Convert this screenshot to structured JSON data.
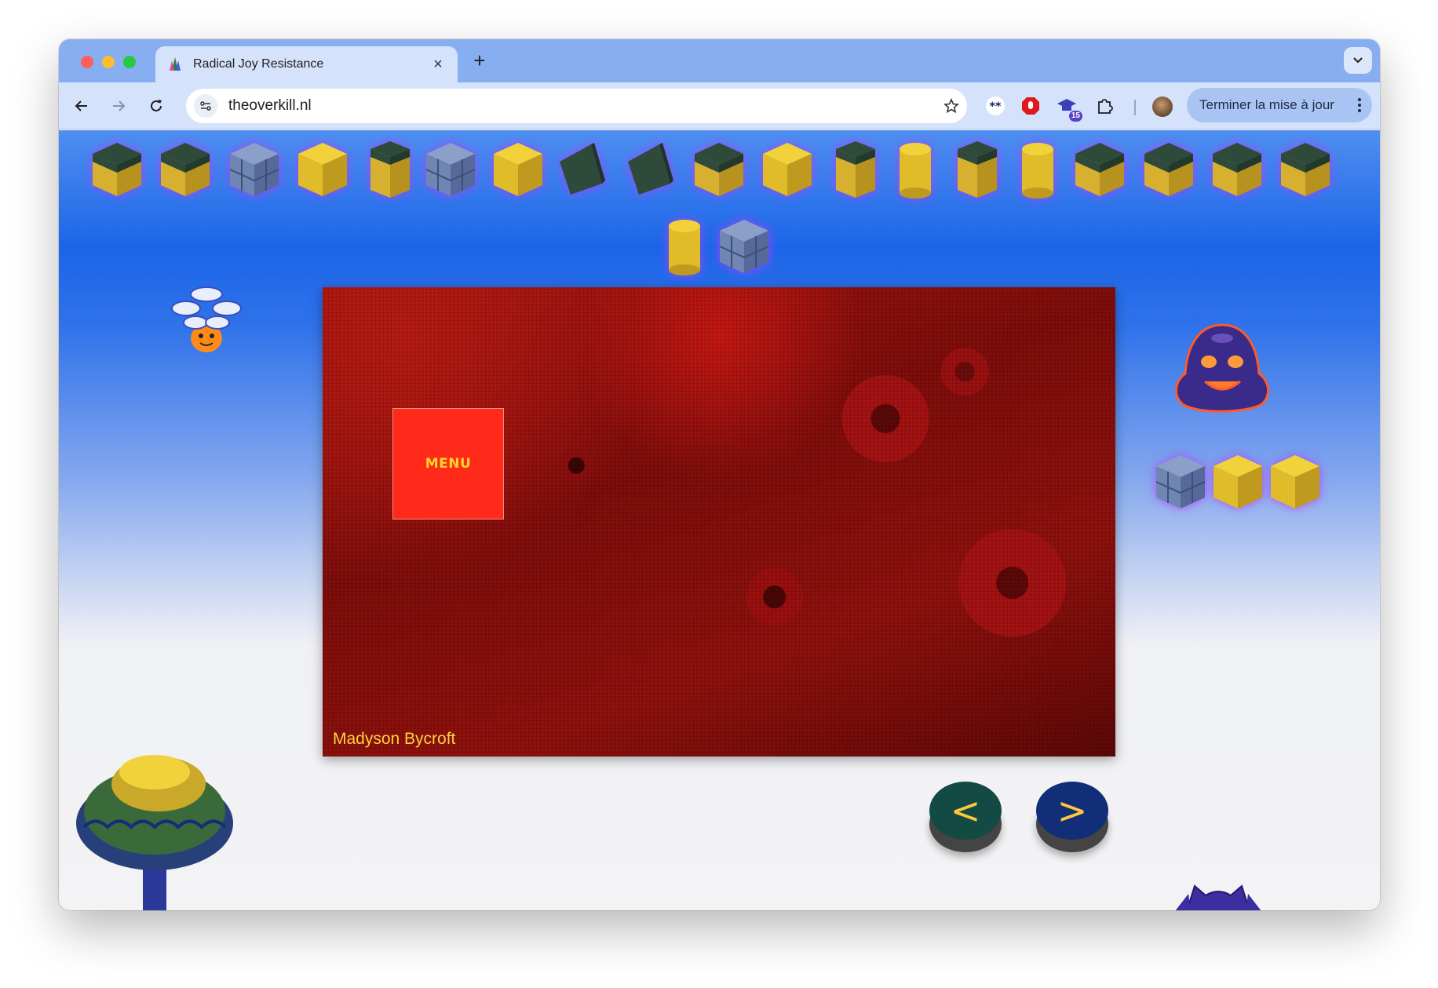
{
  "browser": {
    "tab": {
      "title": "Radical Joy Resistance",
      "close_icon": "close-icon"
    },
    "new_tab_label": "+",
    "url": "theoverkill.nl",
    "update_button_label": "Terminer la mise à jour",
    "extension_badge": "15"
  },
  "page": {
    "menu_label": "MENU",
    "artwork_caption": "Madyson Bycroft",
    "prev_label": "<",
    "next_label": ">"
  },
  "colors": {
    "tab_strip": "#87aef0",
    "toolbar": "#d4e2fb",
    "menu_button": "#ff2a1a",
    "menu_text": "#ffd62a",
    "caption_text": "#ffd23a",
    "prev_button": "#134a44",
    "next_button": "#132e78"
  },
  "blocks_top_row": [
    "grass-block-icon",
    "grass-block-icon",
    "stone-block-icon",
    "sand-block-icon",
    "grass-pillar-icon",
    "stone-block-icon",
    "sand-block-icon",
    "grass-slope-icon",
    "grass-slope-icon",
    "grass-block-icon",
    "sand-block-icon",
    "grass-pillar-icon",
    "sand-cylinder-icon",
    "grass-pillar-icon",
    "sand-cylinder-icon",
    "grass-block-icon",
    "grass-block-icon",
    "grass-block-icon",
    "grass-block-icon"
  ],
  "blocks_second_row": [
    "sand-cylinder-icon",
    "stone-block-icon"
  ],
  "blocks_side": [
    "stone-block-icon",
    "sand-block-icon",
    "sand-block-icon"
  ]
}
